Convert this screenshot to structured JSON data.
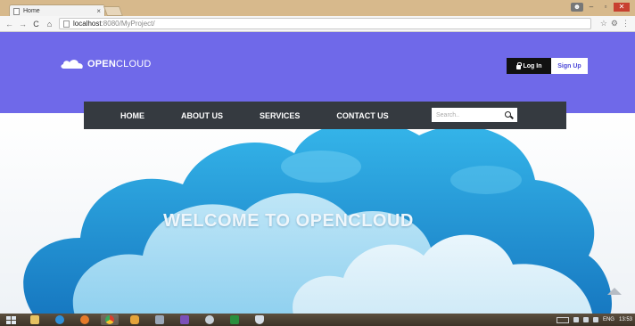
{
  "browser": {
    "tab": {
      "title": "Home",
      "close": "×"
    },
    "address": {
      "host": "localhost",
      "path": ":8080/MyProject/"
    },
    "nav": {
      "back": "←",
      "forward": "→",
      "reload": "C",
      "home": "⌂"
    },
    "toolbar_icons": [
      "bookmark-star-icon",
      "extension-icon",
      "menu-icon"
    ],
    "window_controls": {
      "minimize": "–",
      "maximize": "▫",
      "close": "✕"
    }
  },
  "site": {
    "brand": {
      "bold": "OPEN",
      "light": "CLOUD"
    },
    "auth": {
      "login": "Log In",
      "signup": "Sign Up"
    },
    "nav": [
      "HOME",
      "ABOUT US",
      "SERVICES",
      "CONTACT US"
    ],
    "search": {
      "placeholder": "Search.."
    },
    "hero": {
      "heading": "WELCOME TO OPENCLOUD"
    }
  },
  "taskbar": {
    "tray": {
      "language": "ENG",
      "time": "13:53"
    }
  },
  "colors": {
    "header_band": "#6f69e9",
    "navbar": "#353a40",
    "cloud_dark": "#1e8fd2",
    "cloud_light": "#dff1fb"
  }
}
